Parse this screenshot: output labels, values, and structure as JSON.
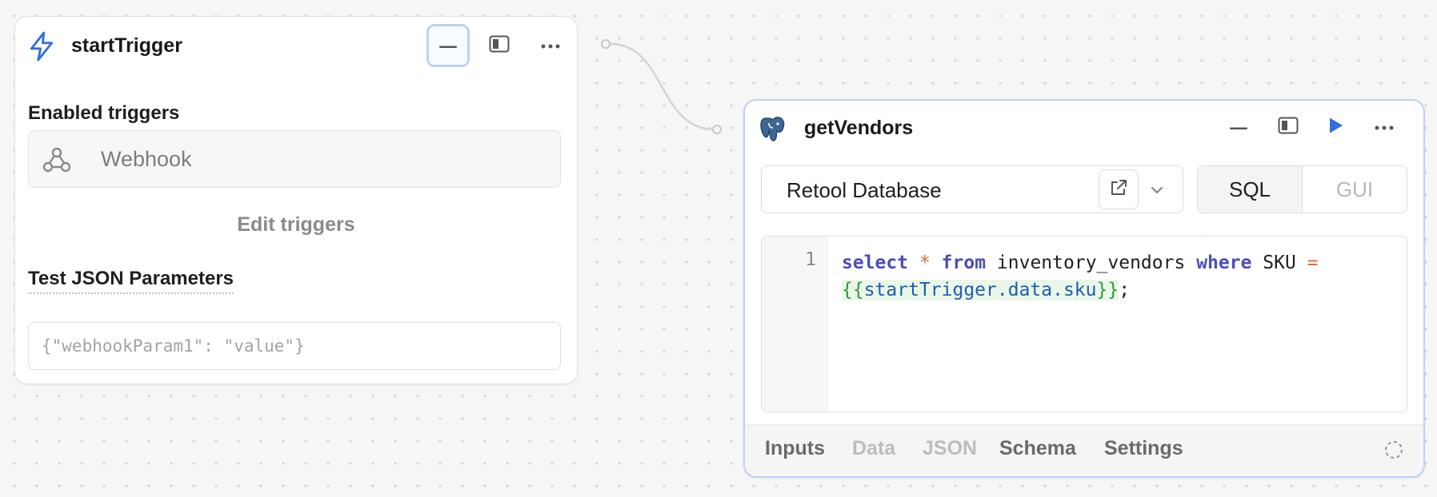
{
  "start_trigger": {
    "title": "startTrigger",
    "enabled_triggers_label": "Enabled triggers",
    "trigger_item": "Webhook",
    "edit_triggers_label": "Edit triggers",
    "test_json_label": "Test JSON Parameters",
    "test_json_placeholder": "{\"webhookParam1\": \"value\"}"
  },
  "get_vendors": {
    "title": "getVendors",
    "resource": "Retool Database",
    "mode_tabs": {
      "sql": "SQL",
      "gui": "GUI",
      "active": "SQL"
    },
    "editor": {
      "line_number": "1",
      "tokens": {
        "select": "select",
        "star": "*",
        "from": "from",
        "table": "inventory_vendors",
        "where": "where",
        "column": "SKU",
        "equals": "=",
        "tmpl_open": "{{",
        "tmpl_expr": "startTrigger.data.sku",
        "tmpl_close": "}}",
        "semicolon": ";"
      }
    },
    "footer_tabs": {
      "inputs": "Inputs",
      "data": "Data",
      "json": "JSON",
      "schema": "Schema",
      "settings": "Settings"
    }
  },
  "icons": [
    "lightning-icon",
    "minimize-icon",
    "sidebar-panel-icon",
    "more-icon",
    "webhook-icon",
    "postgres-elephant-icon",
    "run-icon",
    "external-link-icon",
    "chevron-down-icon",
    "loading-spinner-icon"
  ],
  "colors": {
    "accent": "#2f6fe0",
    "focus_ring": "#bcd3f3",
    "keyword": "#4b4fb3",
    "operator": "#e16a2e",
    "template": "#2f9b3a"
  }
}
